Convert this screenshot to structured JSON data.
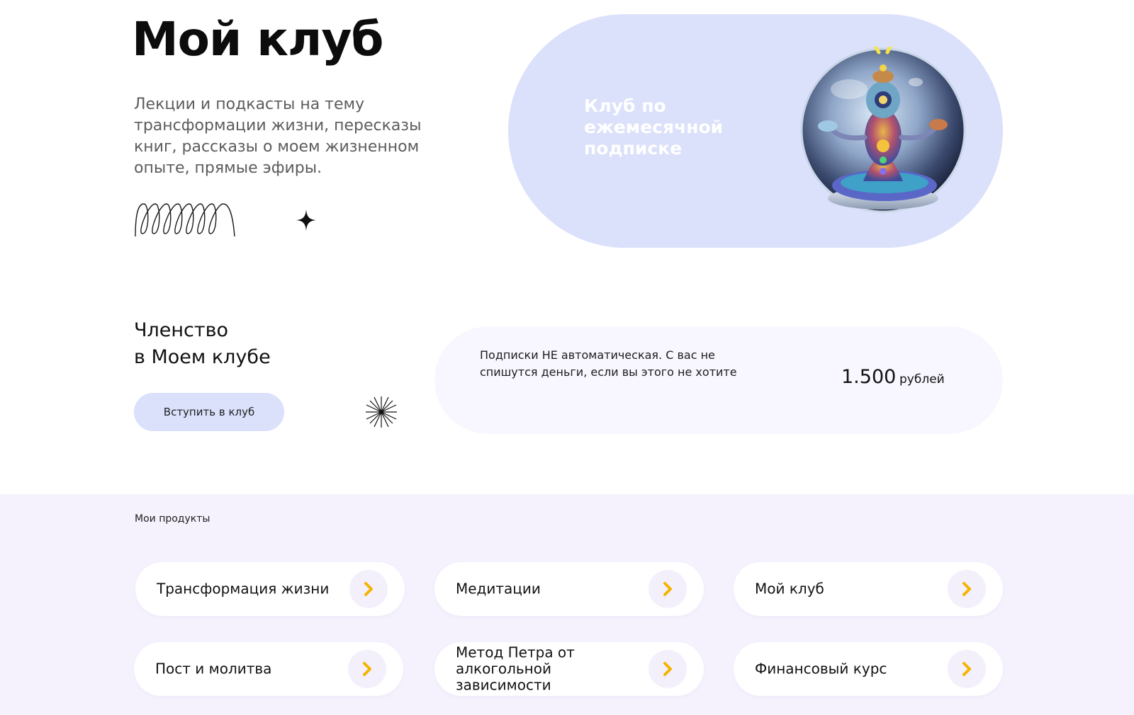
{
  "hero": {
    "title": "Мой клуб",
    "description": "Лекции и подкасты на тему трансформации жизни, пересказы книг, рассказы о моем жизненном опыте, прямые эфиры.",
    "club_card_text": "Клуб по ежемесячной подписке"
  },
  "membership": {
    "title_line1": "Членство",
    "title_line2": "в Моем клубе",
    "join_button": "Вступить в клуб",
    "note": "Подписки НЕ автоматическая. С вас не спишутся деньги, если вы этого не хотите",
    "price": "1.500",
    "currency": "рублей"
  },
  "products": {
    "heading": "Мои продукты",
    "items": [
      {
        "label": "Трансформация жизни"
      },
      {
        "label": "Медитации"
      },
      {
        "label": "Мой клуб"
      },
      {
        "label": "Пост и молитва"
      },
      {
        "label": "Метод Петра от алкогольной зависимости"
      },
      {
        "label": "Финансовый курс"
      }
    ]
  },
  "colors": {
    "accent_lavender": "#dbe0fb",
    "section_bg": "#f5f2fd",
    "arrow_yellow": "#f5b400"
  },
  "icons": {
    "decor_left": "squiggle-loops",
    "decor_star": "four-point-star",
    "decor_burst": "starburst",
    "product_arrow": "chevron-right"
  }
}
